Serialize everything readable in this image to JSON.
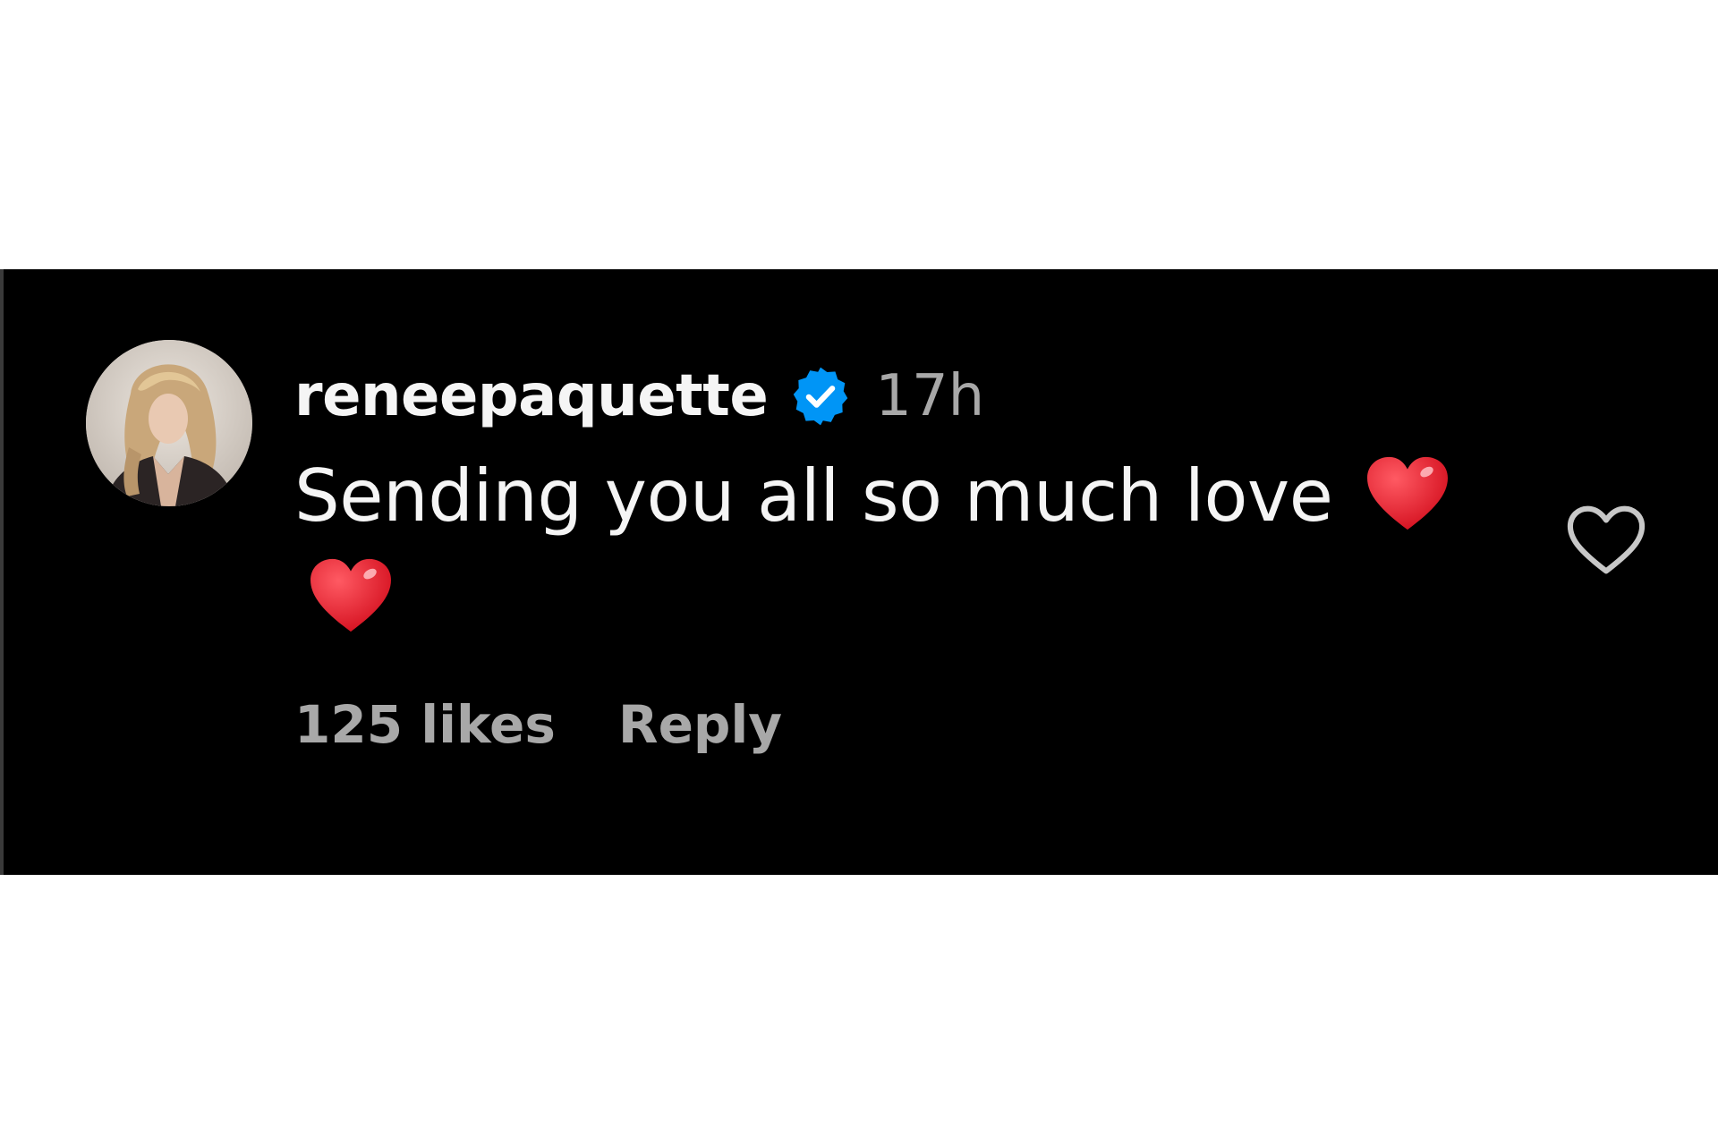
{
  "comment": {
    "username": "reneepaquette",
    "verified_icon": "verified-badge-icon",
    "timestamp": "17h",
    "text": "Sending you all so much love",
    "emoji": [
      "red-heart-emoji",
      "red-heart-emoji"
    ],
    "likes": "125 likes",
    "reply_label": "Reply",
    "like_icon": "heart-outline-icon"
  },
  "colors": {
    "panel_background": "#000000",
    "page_background": "#ffffff",
    "primary_text": "#f5f5f5",
    "secondary_text": "#a8a8a8",
    "verified_blue": "#0095f6",
    "heart_red": "#e8192c"
  }
}
